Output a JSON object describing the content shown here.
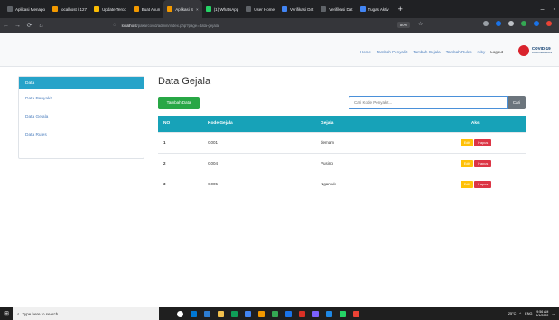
{
  "browser": {
    "tabs": [
      {
        "label": "Aplikasi Menapo",
        "color": "#5f6368"
      },
      {
        "label": "localhost / 127",
        "color": "#f29900"
      },
      {
        "label": "Update Terco",
        "color": "#fbbc04"
      },
      {
        "label": "Buat Akun",
        "color": "#f29900"
      },
      {
        "label": "Aplikasi S",
        "color": "#f29900",
        "active": true
      },
      {
        "label": "(1) WhatsApp",
        "color": "#25d366"
      },
      {
        "label": "User Home",
        "color": "#5f6368"
      },
      {
        "label": "Verifikasi Dat",
        "color": "#4285f4"
      },
      {
        "label": "Verifikasi Dat",
        "color": "#5f6368"
      },
      {
        "label": "Tugas Aktiv",
        "color": "#4285f4"
      }
    ],
    "new_tab": "+",
    "window_controls": {
      "minimize": "–",
      "maximize": "▫"
    },
    "nav": {
      "back": "←",
      "forward": "→",
      "reload": "⟳",
      "home": "⌂"
    },
    "url_host": "localhost",
    "url_path": "/pakarcovid/admin/index.php?page=data-gejala",
    "zoom": "80%"
  },
  "navbar": {
    "links": [
      "Home",
      "Tambah Penyakit",
      "Tambah Gejala",
      "Tambah Rules"
    ],
    "user": "roby",
    "logout": "Logout",
    "logo_text": "COVID-19",
    "logo_sub": "CORONAVIRUS"
  },
  "sidebar": {
    "items": [
      {
        "label": "Data",
        "active": true
      },
      {
        "label": "Data Penyakit"
      },
      {
        "label": "Data Gejala"
      },
      {
        "label": "Data Rules"
      }
    ]
  },
  "main": {
    "title": "Data Gejala",
    "add_button": "Tambah Data",
    "search_placeholder": "Cari Kode Penyakit...",
    "search_button": "Cari",
    "table": {
      "headers": [
        "NO",
        "Kode Gejala",
        "Gejala",
        "Aksi"
      ],
      "rows": [
        {
          "no": "1",
          "kode": "G001",
          "gejala": "demam"
        },
        {
          "no": "2",
          "kode": "G004",
          "gejala": "Pusing"
        },
        {
          "no": "3",
          "kode": "G005",
          "gejala": "Ngantuk"
        }
      ],
      "edit_label": "Edit",
      "delete_label": "Hapus"
    }
  },
  "taskbar": {
    "search_text": "Type here to search",
    "weather": "25°C",
    "lang": "ENG",
    "time": "9:56 AM",
    "date": "6/1/2022"
  }
}
